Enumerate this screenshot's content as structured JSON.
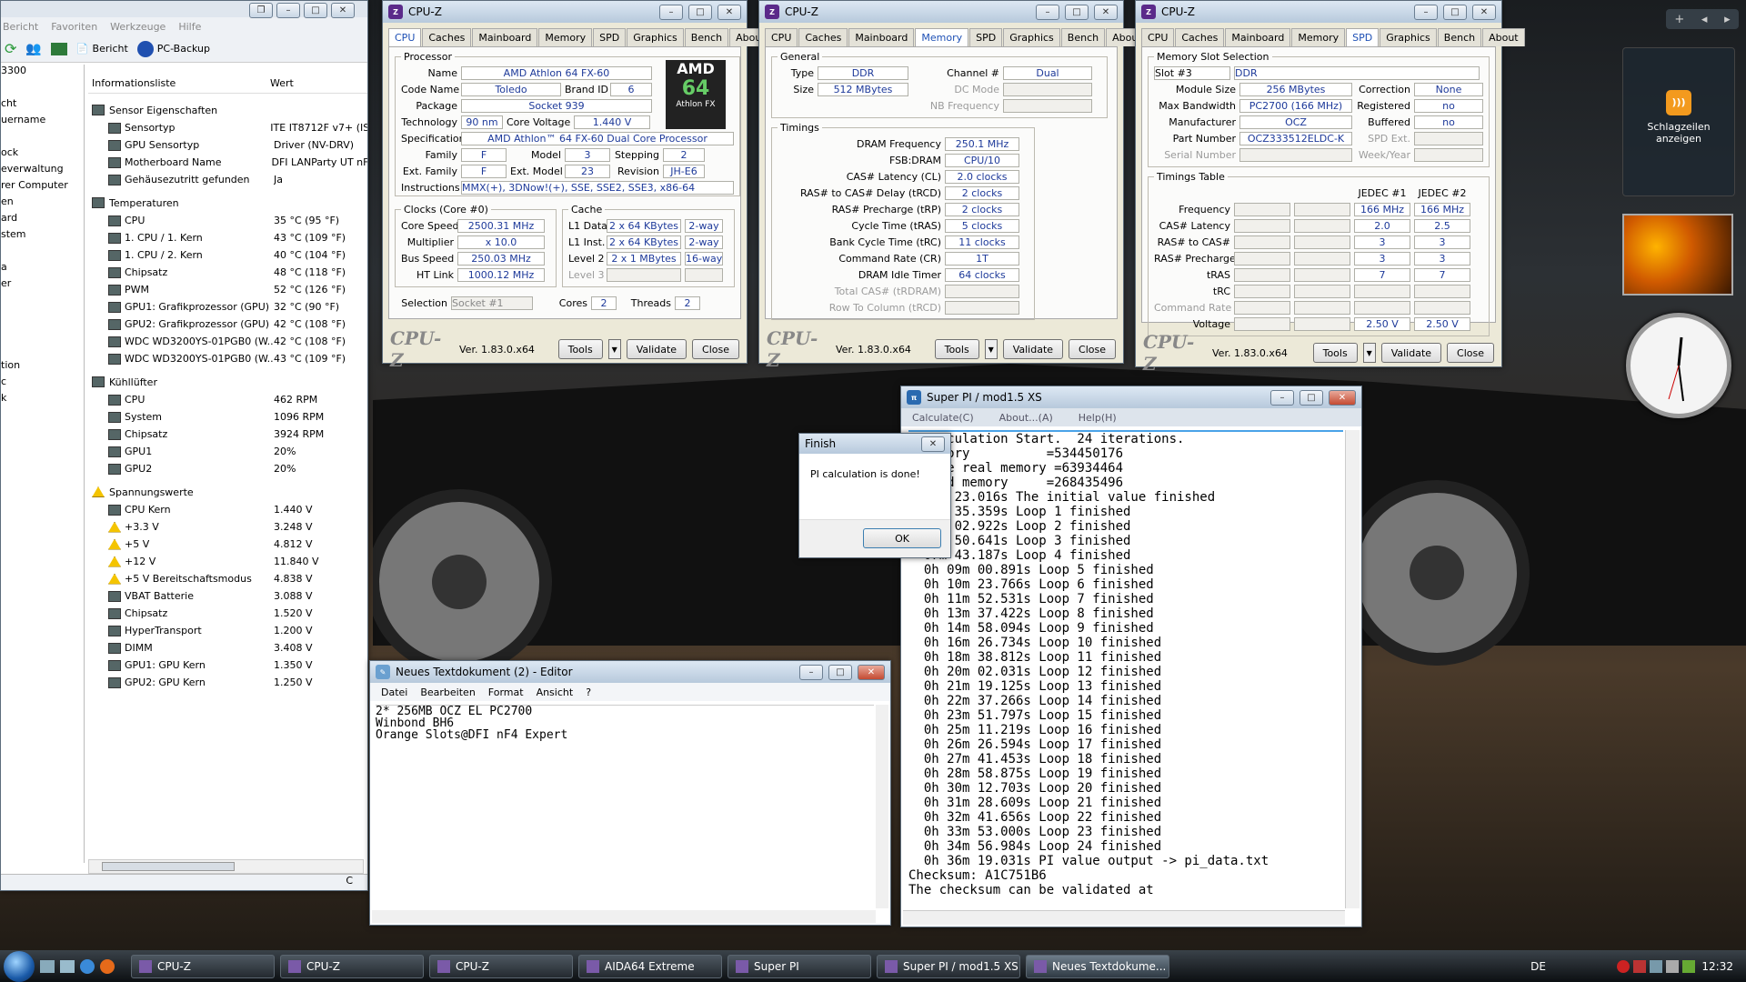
{
  "aida": {
    "menu": [
      "Bericht",
      "Favoriten",
      "Werkzeuge",
      "Hilfe"
    ],
    "toolbar": {
      "report": "Bericht",
      "backup": "PC-Backup"
    },
    "col_info": "Informationsliste",
    "col_value": "Wert",
    "left_stub": [
      "3300",
      "",
      "cht",
      "uername",
      "",
      "ock",
      "everwaltung",
      "rer Computer",
      "en",
      "ard",
      "stem",
      "",
      "a",
      "er",
      "",
      "",
      "",
      "",
      "tion",
      "c",
      "k"
    ],
    "sections": [
      {
        "title": "Sensor Eigenschaften",
        "rows": [
          [
            "Sensortyp",
            "ITE IT8712F v7+ (IS"
          ],
          [
            "GPU Sensortyp",
            "Driver (NV-DRV)"
          ],
          [
            "Motherboard Name",
            "DFI LANParty UT nF"
          ],
          [
            "Gehäusezutritt gefunden",
            "Ja"
          ]
        ]
      },
      {
        "title": "Temperaturen",
        "rows": [
          [
            "CPU",
            "35 °C (95 °F)"
          ],
          [
            "1. CPU / 1. Kern",
            "43 °C (109 °F)"
          ],
          [
            "1. CPU / 2. Kern",
            "40 °C (104 °F)"
          ],
          [
            "Chipsatz",
            "48 °C (118 °F)"
          ],
          [
            "PWM",
            "52 °C (126 °F)"
          ],
          [
            "GPU1: Grafikprozessor (GPU)",
            "32 °C (90 °F)"
          ],
          [
            "GPU2: Grafikprozessor (GPU)",
            "42 °C (108 °F)"
          ],
          [
            "WDC WD3200YS-01PGB0 (W...",
            "42 °C (108 °F)"
          ],
          [
            "WDC WD3200YS-01PGB0 (W...",
            "43 °C (109 °F)"
          ]
        ]
      },
      {
        "title": "Kühllüfter",
        "rows": [
          [
            "CPU",
            "462 RPM"
          ],
          [
            "System",
            "1096 RPM"
          ],
          [
            "Chipsatz",
            "3924 RPM"
          ],
          [
            "GPU1",
            "20%"
          ],
          [
            "GPU2",
            "20%"
          ]
        ]
      },
      {
        "title": "Spannungswerte",
        "rows": [
          [
            "CPU Kern",
            "1.440 V"
          ],
          [
            "+3.3 V",
            "3.248 V"
          ],
          [
            "+5 V",
            "4.812 V"
          ],
          [
            "+12 V",
            "11.840 V"
          ],
          [
            "+5 V Bereitschaftsmodus",
            "4.838 V"
          ],
          [
            "VBAT Batterie",
            "3.088 V"
          ],
          [
            "Chipsatz",
            "1.520 V"
          ],
          [
            "HyperTransport",
            "1.200 V"
          ],
          [
            "DIMM",
            "3.408 V"
          ],
          [
            "GPU1: GPU Kern",
            "1.350 V"
          ],
          [
            "GPU2: GPU Kern",
            "1.250 V"
          ]
        ]
      }
    ],
    "status": "C"
  },
  "cpuz": {
    "title": "CPU-Z",
    "tabs": [
      "CPU",
      "Caches",
      "Mainboard",
      "Memory",
      "SPD",
      "Graphics",
      "Bench",
      "About"
    ],
    "version": "Ver. 1.83.0.x64",
    "tools": "Tools",
    "validate": "Validate",
    "close": "Close",
    "logo": "CPU-Z",
    "cpu": {
      "processor": "Processor",
      "name_l": "Name",
      "name": "AMD Athlon 64 FX-60",
      "code_l": "Code Name",
      "code": "Toledo",
      "brand_l": "Brand ID",
      "brand": "6",
      "pkg_l": "Package",
      "pkg": "Socket 939",
      "tech_l": "Technology",
      "tech": "90 nm",
      "volt_l": "Core Voltage",
      "volt": "1.440 V",
      "spec_l": "Specification",
      "spec": "AMD Athlon™ 64 FX-60 Dual Core Processor",
      "fam_l": "Family",
      "fam": "F",
      "model_l": "Model",
      "model": "3",
      "step_l": "Stepping",
      "step": "2",
      "efam_l": "Ext. Family",
      "efam": "F",
      "emod_l": "Ext. Model",
      "emod": "23",
      "rev_l": "Revision",
      "rev": "JH-E6",
      "ins_l": "Instructions",
      "ins": "MMX(+), 3DNow!(+), SSE, SSE2, SSE3, x86-64",
      "clocks": "Clocks (Core #0)",
      "cs_l": "Core Speed",
      "cs": "2500.31 MHz",
      "mul_l": "Multiplier",
      "mul": "x 10.0",
      "bus_l": "Bus Speed",
      "bus": "250.03 MHz",
      "ht_l": "HT Link",
      "ht": "1000.12 MHz",
      "cache": "Cache",
      "l1d_l": "L1 Data",
      "l1d": "2 x 64 KBytes",
      "l1d_w": "2-way",
      "l1i_l": "L1 Inst.",
      "l1i": "2 x 64 KBytes",
      "l1i_w": "2-way",
      "l2_l": "Level 2",
      "l2": "2 x 1 MBytes",
      "l2_w": "16-way",
      "l3_l": "Level 3",
      "sel_l": "Selection",
      "sel": "Socket #1",
      "cores_l": "Cores",
      "cores": "2",
      "thr_l": "Threads",
      "thr": "2",
      "amd": "AMD",
      "athlon": "Athlon FX"
    },
    "mem": {
      "general": "General",
      "type_l": "Type",
      "type": "DDR",
      "ch_l": "Channel #",
      "ch": "Dual",
      "size_l": "Size",
      "size": "512 MBytes",
      "dc_l": "DC Mode",
      "nb_l": "NB Frequency",
      "timings": "Timings",
      "rows": [
        [
          "DRAM Frequency",
          "250.1 MHz"
        ],
        [
          "FSB:DRAM",
          "CPU/10"
        ],
        [
          "CAS# Latency (CL)",
          "2.0 clocks"
        ],
        [
          "RAS# to CAS# Delay (tRCD)",
          "2 clocks"
        ],
        [
          "RAS# Precharge (tRP)",
          "2 clocks"
        ],
        [
          "Cycle Time (tRAS)",
          "5 clocks"
        ],
        [
          "Bank Cycle Time (tRC)",
          "11 clocks"
        ],
        [
          "Command Rate (CR)",
          "1T"
        ],
        [
          "DRAM Idle Timer",
          "64 clocks"
        ],
        [
          "Total CAS# (tRDRAM)",
          ""
        ],
        [
          "Row To Column (tRCD)",
          ""
        ]
      ]
    },
    "spd": {
      "slotsel": "Memory Slot Selection",
      "slot": "Slot #3",
      "type": "DDR",
      "msize_l": "Module Size",
      "msize": "256 MBytes",
      "maxbw_l": "Max Bandwidth",
      "maxbw": "PC2700 (166 MHz)",
      "manu_l": "Manufacturer",
      "manu": "OCZ",
      "part_l": "Part Number",
      "part": "OCZ333512ELDC-K",
      "serial_l": "Serial Number",
      "corr_l": "Correction",
      "corr": "None",
      "reg_l": "Registered",
      "reg": "no",
      "buf_l": "Buffered",
      "buf": "no",
      "spdext_l": "SPD Ext.",
      "week_l": "Week/Year",
      "ttable": "Timings Table",
      "jedec1": "JEDEC #1",
      "jedec2": "JEDEC #2",
      "trows": [
        [
          "Frequency",
          "166 MHz",
          "166 MHz"
        ],
        [
          "CAS# Latency",
          "2.0",
          "2.5"
        ],
        [
          "RAS# to CAS#",
          "3",
          "3"
        ],
        [
          "RAS# Precharge",
          "3",
          "3"
        ],
        [
          "tRAS",
          "7",
          "7"
        ],
        [
          "tRC",
          "",
          ""
        ],
        [
          "Command Rate",
          "",
          ""
        ],
        [
          "Voltage",
          "2.50 V",
          "2.50 V"
        ]
      ]
    }
  },
  "superpi": {
    "title": "Super PI / mod1.5 XS",
    "menu": [
      "Calculate(C)",
      "About...(A)",
      "Help(H)"
    ],
    "lines": [
      "  Calculation Start.  24 iterations.",
      "  memory          =534450176",
      "  able real memory =63934464",
      "  ated memory     =268435496",
      "  00m 23.016s The initial value finished",
      "  01m 35.359s Loop 1 finished",
      "  04m 02.922s Loop 2 finished",
      "  05m 50.641s Loop 3 finished",
      "  07m 43.187s Loop 4 finished",
      "  0h 09m 00.891s Loop 5 finished",
      "  0h 10m 23.766s Loop 6 finished",
      "  0h 11m 52.531s Loop 7 finished",
      "  0h 13m 37.422s Loop 8 finished",
      "  0h 14m 58.094s Loop 9 finished",
      "  0h 16m 26.734s Loop 10 finished",
      "  0h 18m 38.812s Loop 11 finished",
      "  0h 20m 02.031s Loop 12 finished",
      "  0h 21m 19.125s Loop 13 finished",
      "  0h 22m 37.266s Loop 14 finished",
      "  0h 23m 51.797s Loop 15 finished",
      "  0h 25m 11.219s Loop 16 finished",
      "  0h 26m 26.594s Loop 17 finished",
      "  0h 27m 41.453s Loop 18 finished",
      "  0h 28m 58.875s Loop 19 finished",
      "  0h 30m 12.703s Loop 20 finished",
      "  0h 31m 28.609s Loop 21 finished",
      "  0h 32m 41.656s Loop 22 finished",
      "  0h 33m 53.000s Loop 23 finished",
      "  0h 34m 56.984s Loop 24 finished",
      "  0h 36m 19.031s PI value output -> pi_data.txt",
      "",
      "Checksum: A1C751B6",
      "The checksum can be validated at"
    ]
  },
  "finish": {
    "title": "Finish",
    "msg": "PI calculation is done!",
    "ok": "OK"
  },
  "notepad": {
    "title": "Neues Textdokument (2) - Editor",
    "menu": [
      "Datei",
      "Bearbeiten",
      "Format",
      "Ansicht",
      "?"
    ],
    "lines": [
      "2* 256MB OCZ EL PC2700",
      "Winbond BH6",
      "Orange Slots@DFI nF4 Expert"
    ]
  },
  "gadget": {
    "rss": "Schlagzeilen anzeigen"
  },
  "taskbar": {
    "items": [
      "CPU-Z",
      "CPU-Z",
      "CPU-Z",
      "AIDA64 Extreme",
      "Super PI",
      "Super PI / mod1.5 XS",
      "Neues Textdokume..."
    ],
    "lang": "DE",
    "time": "12:32"
  }
}
